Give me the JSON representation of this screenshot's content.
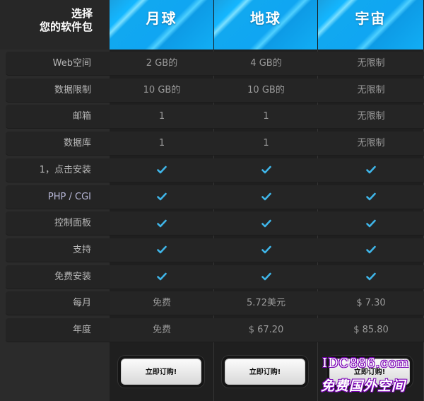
{
  "header": {
    "choose_line1": "选择",
    "choose_line2": "您的软件包",
    "plans": [
      "月球",
      "地球",
      "宇宙"
    ]
  },
  "features": [
    {
      "label": "Web空间",
      "values": [
        "2 GB的",
        "4 GB的",
        "无限制"
      ]
    },
    {
      "label": "数据限制",
      "values": [
        "10 GB的",
        "10 GB的",
        "无限制"
      ]
    },
    {
      "label": "邮箱",
      "values": [
        "1",
        "1",
        "无限制"
      ]
    },
    {
      "label": "数据库",
      "values": [
        "1",
        "1",
        "无限制"
      ]
    },
    {
      "label": "1，点击安装",
      "values": [
        "check",
        "check",
        "check"
      ]
    },
    {
      "label": "PHP / CGI",
      "values": [
        "check",
        "check",
        "check"
      ]
    },
    {
      "label": "控制面板",
      "values": [
        "check",
        "check",
        "check"
      ]
    },
    {
      "label": "支持",
      "values": [
        "check",
        "check",
        "check"
      ]
    },
    {
      "label": "免费安装",
      "values": [
        "check",
        "check",
        "check"
      ]
    },
    {
      "label": "每月",
      "values": [
        "免费",
        "5.72美元",
        "$ 7.30"
      ]
    },
    {
      "label": "年度",
      "values": [
        "免费",
        "$ 67.20",
        "$ 85.80"
      ]
    }
  ],
  "buttons": {
    "order_label": "立即订购!"
  },
  "watermark": {
    "line1": "IDC886.com",
    "line2": "免费国外空间"
  },
  "colors": {
    "header_blue": "#12aef5",
    "check": "#3fb5e8",
    "background": "#2b2b2b"
  }
}
